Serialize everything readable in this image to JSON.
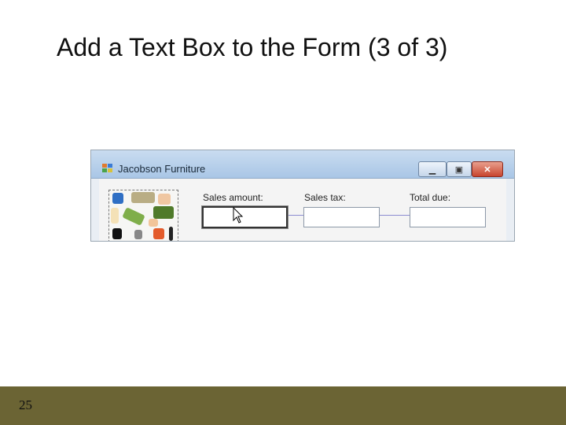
{
  "slide": {
    "title": "Add a Text Box to the Form (3 of 3)",
    "page_number": "25"
  },
  "window": {
    "title": "Jacobson Furniture",
    "icon": "app-form-icon",
    "controls": {
      "minimize_icon": "minimize-icon",
      "maximize_icon": "maximize-icon",
      "close_icon": "close-icon"
    }
  },
  "form": {
    "labels": {
      "sales_amount": "Sales amount:",
      "sales_tax": "Sales tax:",
      "total_due": "Total due:"
    },
    "textboxes": {
      "sales_amount_value": "",
      "sales_tax_value": "",
      "total_due_value": ""
    }
  },
  "colors": {
    "footer": "#6b6434",
    "titlebar": "#a9c6e6"
  }
}
